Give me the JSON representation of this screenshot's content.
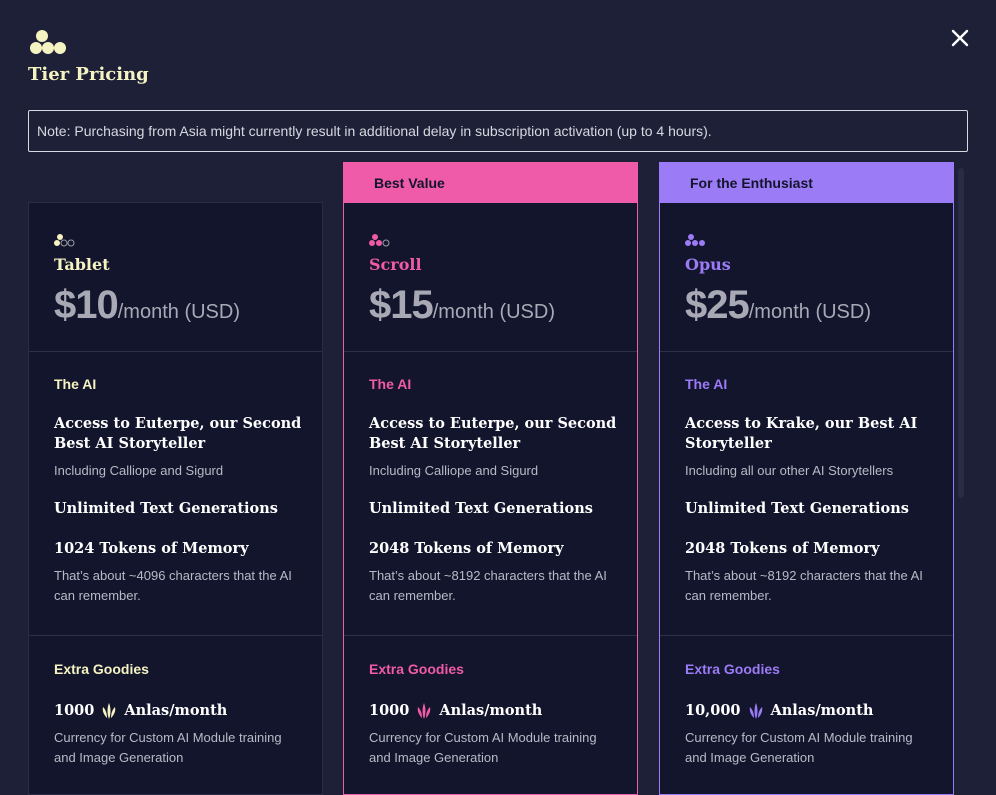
{
  "header": {
    "title": "Tier Pricing",
    "note": "Note: Purchasing from Asia might currently result in additional delay in subscription activation (up to 4 hours)."
  },
  "colors": {
    "background": "#1e2037",
    "card": "#13152c",
    "tablet_accent": "#f5f3c2",
    "scroll_accent": "#ef5ba9",
    "opus_accent": "#9b7cf6"
  },
  "tiers": [
    {
      "name": "Tablet",
      "banner": "",
      "amount": "$10",
      "period": "/month (USD)",
      "ai_label": "The AI",
      "model_title": "Access to Euterpe, our Second Best AI Storyteller",
      "model_sub": "Including Calliope and Sigurd",
      "generations": "Unlimited Text Generations",
      "memory_title": "1024 Tokens of Memory",
      "memory_sub": "That’s about ~4096 characters that the AI can remember.",
      "extras_label": "Extra Goodies",
      "anlas_count": "1000",
      "anlas_unit": "Anlas/month",
      "anlas_sub": "Currency for Custom AI Module training and Image Generation",
      "icon": "tablet-tier-icon"
    },
    {
      "name": "Scroll",
      "banner": "Best Value",
      "amount": "$15",
      "period": "/month (USD)",
      "ai_label": "The AI",
      "model_title": "Access to Euterpe, our Second Best AI Storyteller",
      "model_sub": "Including Calliope and Sigurd",
      "generations": "Unlimited Text Generations",
      "memory_title": "2048 Tokens of Memory",
      "memory_sub": "That’s about ~8192 characters that the AI can remember.",
      "extras_label": "Extra Goodies",
      "anlas_count": "1000",
      "anlas_unit": "Anlas/month",
      "anlas_sub": "Currency for Custom AI Module training and Image Generation",
      "icon": "scroll-tier-icon"
    },
    {
      "name": "Opus",
      "banner": "For the Enthusiast",
      "amount": "$25",
      "period": "/month (USD)",
      "ai_label": "The AI",
      "model_title": "Access to Krake, our Best AI Storyteller",
      "model_sub": "Including all our other AI Storytellers",
      "generations": "Unlimited Text Generations",
      "memory_title": "2048 Tokens of Memory",
      "memory_sub": "That’s about ~8192 characters that the AI can remember.",
      "extras_label": "Extra Goodies",
      "anlas_count": "10,000",
      "anlas_unit": "Anlas/month",
      "anlas_sub": "Currency for Custom AI Module training and Image Generation",
      "icon": "opus-tier-icon"
    }
  ]
}
